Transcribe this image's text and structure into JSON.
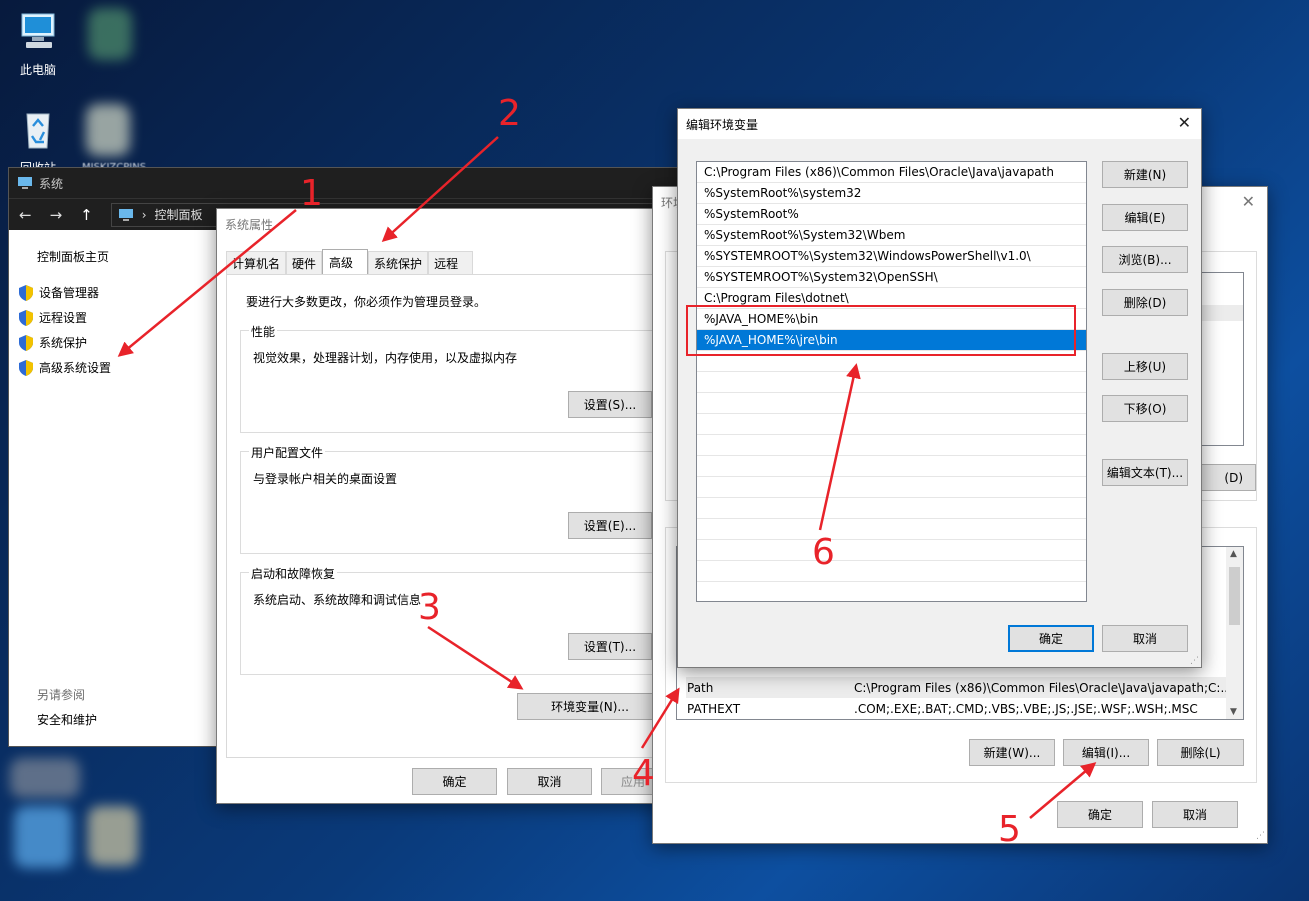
{
  "desktop": {
    "icons": [
      {
        "label": "此电脑"
      },
      {
        "label": "回收站"
      }
    ],
    "partial_label": "MISKIZCPINS"
  },
  "explorer": {
    "title": "系统",
    "breadcrumb": "控制面板",
    "sidebar": {
      "home": "控制面板主页",
      "items": [
        {
          "label": "设备管理器"
        },
        {
          "label": "远程设置"
        },
        {
          "label": "系统保护"
        },
        {
          "label": "高级系统设置"
        }
      ],
      "see_also": "另请参阅",
      "security": "安全和维护"
    }
  },
  "sysprops": {
    "title": "系统属性",
    "tabs": [
      "计算机名",
      "硬件",
      "高级",
      "系统保护",
      "远程"
    ],
    "admin_note": "要进行大多数更改，你必须作为管理员登录。",
    "perf_label": "性能",
    "perf_desc": "视觉效果，处理器计划，内存使用，以及虚拟内存",
    "perf_btn": "设置(S)...",
    "profile_label": "用户配置文件",
    "profile_desc": "与登录帐户相关的桌面设置",
    "profile_btn": "设置(E)...",
    "startup_label": "启动和故障恢复",
    "startup_desc": "系统启动、系统故障和调试信息",
    "startup_btn": "设置(T)...",
    "envvars_btn": "环境变量(N)...",
    "ok": "确定",
    "cancel": "取消",
    "apply": "应用"
  },
  "envvars": {
    "title": "环境变量",
    "user_edit_partial": "(D)",
    "sys_rows": [
      {
        "name": "Path",
        "value": "C:\\Program Files (x86)\\Common Files\\Oracle\\Java\\javapath;C:..."
      },
      {
        "name": "PATHEXT",
        "value": ".COM;.EXE;.BAT;.CMD;.VBS;.VBE;.JS;.JSE;.WSF;.WSH;.MSC"
      }
    ],
    "new_btn": "新建(W)...",
    "edit_btn": "编辑(I)...",
    "delete_btn": "删除(L)",
    "ok": "确定",
    "cancel": "取消"
  },
  "editenv": {
    "title": "编辑环境变量",
    "paths": [
      "C:\\Program Files (x86)\\Common Files\\Oracle\\Java\\javapath",
      "%SystemRoot%\\system32",
      "%SystemRoot%",
      "%SystemRoot%\\System32\\Wbem",
      "%SYSTEMROOT%\\System32\\WindowsPowerShell\\v1.0\\",
      "%SYSTEMROOT%\\System32\\OpenSSH\\",
      "C:\\Program Files\\dotnet\\",
      "%JAVA_HOME%\\bin",
      "%JAVA_HOME%\\jre\\bin"
    ],
    "selected_index": 8,
    "buttons": {
      "new": "新建(N)",
      "edit": "编辑(E)",
      "browse": "浏览(B)...",
      "delete": "删除(D)",
      "up": "上移(U)",
      "down": "下移(O)",
      "edit_text": "编辑文本(T)..."
    },
    "ok": "确定",
    "cancel": "取消"
  },
  "annotations": {
    "color": "#e8232a",
    "steps": [
      "1",
      "2",
      "3",
      "4",
      "5",
      "6"
    ]
  }
}
